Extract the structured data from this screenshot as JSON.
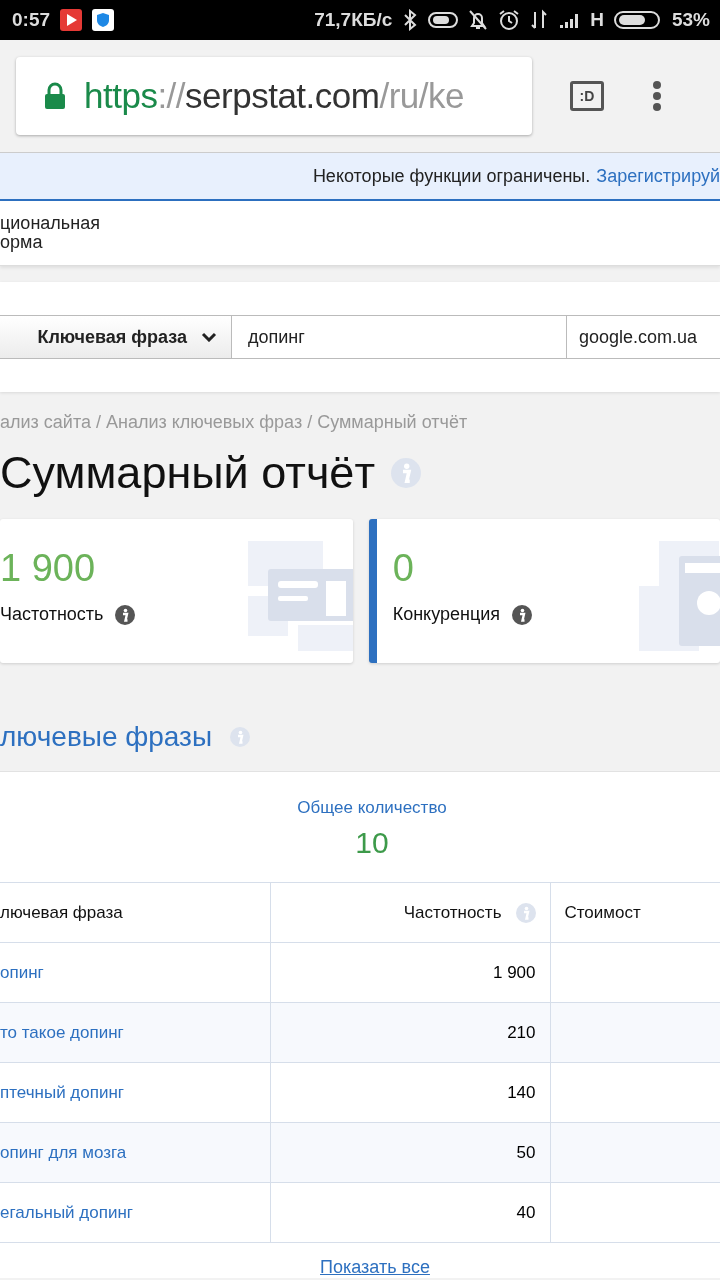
{
  "status_bar": {
    "time": "0:57",
    "speed": "71,7КБ/с",
    "network": "H",
    "battery": "53%"
  },
  "browser": {
    "url_scheme": "https",
    "url_sep": "://",
    "url_host": "serpstat.com",
    "url_path": "/ru/ke",
    "tabs_label": ":D"
  },
  "notice": {
    "text": "Некоторые функции ограничены.",
    "link": "Зарегистрируй"
  },
  "plan_lines": [
    "циональная",
    "орма"
  ],
  "search": {
    "mode": "Ключевая фраза",
    "query": "допинг",
    "engine": "google.com.ua"
  },
  "breadcrumb": "ализ сайта / Анализ ключевых фраз / Суммарный отчёт",
  "title": "Суммарный отчёт",
  "stat_cards": [
    {
      "value": "1 900",
      "label": "Частотность",
      "highlighted": false
    },
    {
      "value": "0",
      "label": "Конкуренция",
      "highlighted": true
    }
  ],
  "section": {
    "title": "лючевые фразы",
    "total_label": "Общее количество",
    "total": "10"
  },
  "table": {
    "columns": [
      "лючевая фраза",
      "Частотность",
      "Стоимост"
    ],
    "rows": [
      {
        "phrase": "опинг",
        "volume": "1 900"
      },
      {
        "phrase": "то такое допинг",
        "volume": "210"
      },
      {
        "phrase": "птечный допинг",
        "volume": "140"
      },
      {
        "phrase": "опинг для мозга",
        "volume": "50"
      },
      {
        "phrase": "егальный допинг",
        "volume": "40"
      }
    ]
  },
  "show_all": "Показать все"
}
